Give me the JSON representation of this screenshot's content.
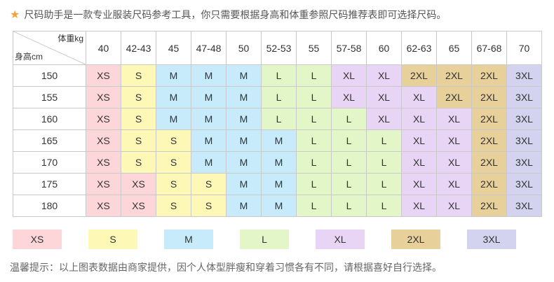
{
  "header": {
    "icon": "star-icon",
    "text": "尺码助手是一款专业服装尺码参考工具，你只需要根据身高和体重参照尺码推荐表即可选择尺码。"
  },
  "table": {
    "corner_weight": "体重kg",
    "corner_height": "身高cm",
    "weights": [
      "40",
      "42-43",
      "45",
      "47-48",
      "50",
      "52-53",
      "55",
      "57-58",
      "60",
      "62-63",
      "65",
      "67-68",
      "70"
    ],
    "heights": [
      "150",
      "155",
      "160",
      "165",
      "170",
      "175",
      "180"
    ],
    "rows": [
      [
        "XS",
        "S",
        "M",
        "M",
        "M",
        "L",
        "L",
        "XL",
        "XL",
        "2XL",
        "2XL",
        "2XL",
        "3XL"
      ],
      [
        "XS",
        "S",
        "M",
        "M",
        "M",
        "L",
        "L",
        "XL",
        "XL",
        "XL",
        "2XL",
        "2XL",
        "3XL"
      ],
      [
        "XS",
        "S",
        "M",
        "M",
        "M",
        "L",
        "L",
        "L",
        "XL",
        "XL",
        "XL",
        "2XL",
        "3XL"
      ],
      [
        "XS",
        "S",
        "S",
        "M",
        "M",
        "M",
        "L",
        "L",
        "L",
        "XL",
        "XL",
        "2XL",
        "3XL"
      ],
      [
        "XS",
        "S",
        "S",
        "M",
        "M",
        "M",
        "L",
        "L",
        "L",
        "XL",
        "XL",
        "2XL",
        "3XL"
      ],
      [
        "XS",
        "XS",
        "S",
        "S",
        "M",
        "M",
        "L",
        "L",
        "L",
        "XL",
        "XL",
        "2XL",
        "3XL"
      ],
      [
        "XS",
        "XS",
        "S",
        "S",
        "M",
        "M",
        "L",
        "L",
        "L",
        "XL",
        "XL",
        "2XL",
        "3XL"
      ]
    ]
  },
  "colors": {
    "XS": "#fcd6d8",
    "S": "#fdf8b6",
    "M": "#c7ebfb",
    "L": "#e3f6c8",
    "XL": "#e8d4f4",
    "2XL": "#e8d09b",
    "3XL": "#d3d3ef"
  },
  "legend": [
    "XS",
    "S",
    "M",
    "L",
    "XL",
    "2XL",
    "3XL"
  ],
  "note": "温馨提示：以上图表数据由商家提供，因个人体型胖瘦和穿着习惯各有不同，请根据喜好自行选择。"
}
